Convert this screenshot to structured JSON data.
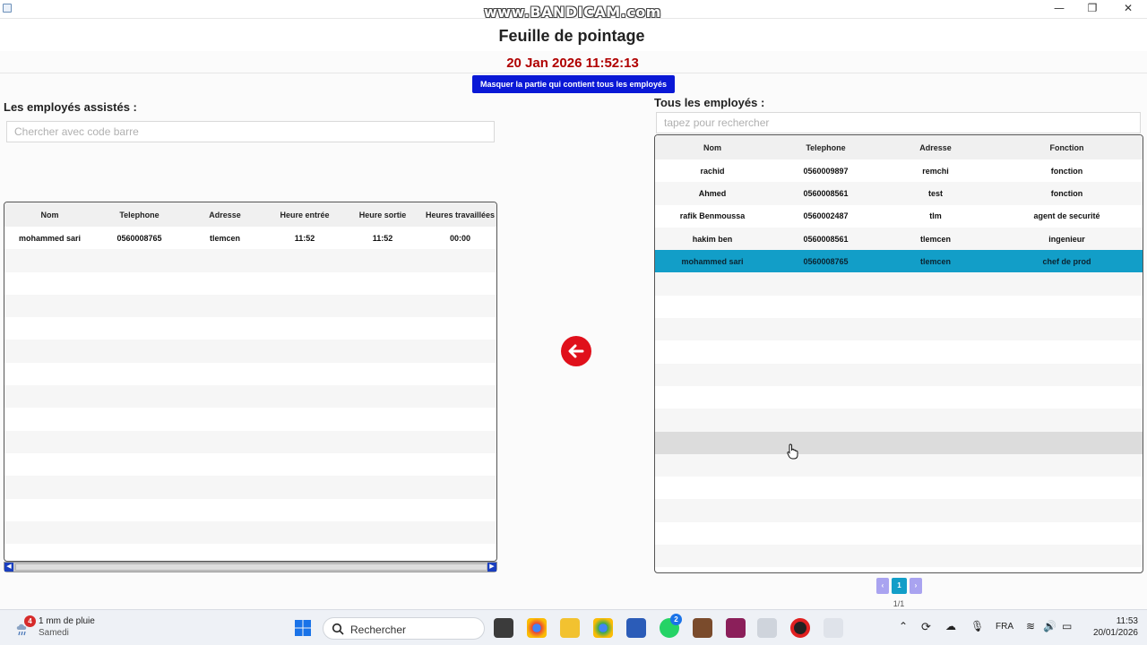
{
  "window": {
    "watermark": "www.BANDICAM.com",
    "minimize": "—",
    "restore": "❐",
    "close": "✕"
  },
  "header": {
    "title": "Feuille de pointage",
    "datetime": "20 Jan 2026 11:52:13",
    "toggle_label": "Masquer la partie qui contient tous les employés"
  },
  "left": {
    "label": "Les employés assistés :",
    "search_placeholder": "Chercher avec code barre",
    "columns": [
      "Nom",
      "Telephone",
      "Adresse",
      "Heure entrée",
      "Heure sortie",
      "Heures travaillées"
    ],
    "rows": [
      [
        "mohammed sari",
        "0560008765",
        "tlemcen",
        "11:52",
        "11:52",
        "00:00"
      ]
    ]
  },
  "right": {
    "label": "Tous les employés :",
    "search_placeholder": "tapez pour rechercher",
    "columns": [
      "Nom",
      "Telephone",
      "Adresse",
      "Fonction"
    ],
    "rows": [
      [
        "rachid",
        "0560009897",
        "remchi",
        "fonction"
      ],
      [
        "Ahmed",
        "0560008561",
        "test",
        "fonction"
      ],
      [
        "rafik Benmoussa",
        "0560002487",
        "tlm",
        "agent de securité"
      ],
      [
        "hakim ben",
        "0560008561",
        "tlemcen",
        "ingenieur"
      ],
      [
        "mohammed sari",
        "0560008765",
        "tlemcen",
        "chef de prod"
      ]
    ],
    "selected_row": 4,
    "pagination": {
      "prev": "‹",
      "current": "1",
      "next": "›",
      "info": "1/1"
    }
  },
  "taskbar": {
    "weather_badge": "4",
    "weather_line1": "1 mm de pluie",
    "weather_line2": "Samedi",
    "search_label": "Rechercher",
    "whatsapp_badge": "2",
    "language": "FRA",
    "time": "11:53",
    "date": "20/01/2026"
  },
  "colors": {
    "accent_blue": "#0a18d6",
    "clock_red": "#b00000",
    "selected_row": "#129ec8",
    "back_button": "#e0101b",
    "pager": "#a9a3f0",
    "pager_active": "#129ec8"
  }
}
